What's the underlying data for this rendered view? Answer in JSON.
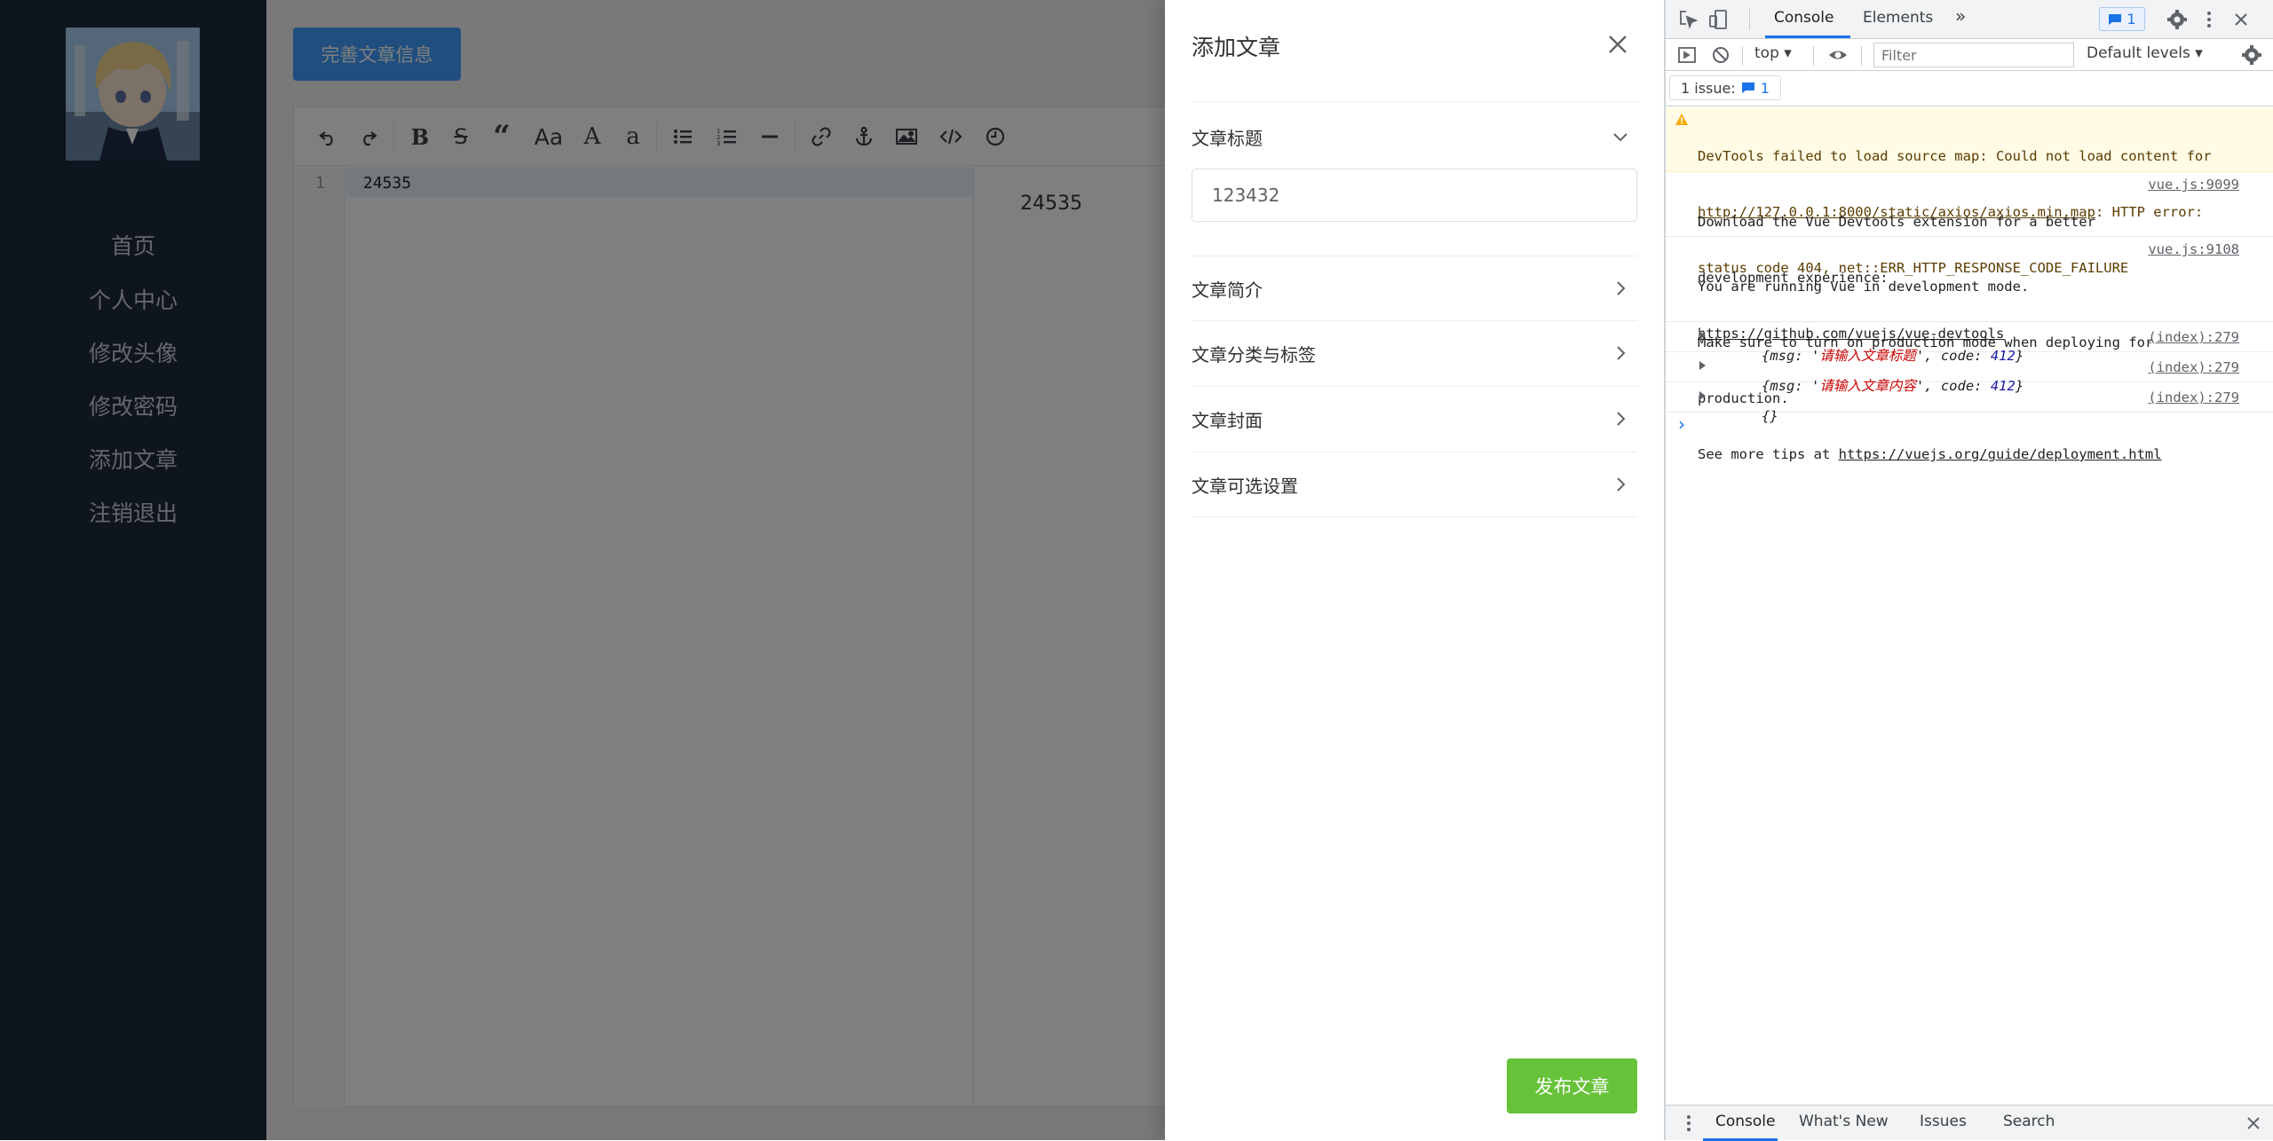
{
  "sidebar": {
    "nav": [
      "首页",
      "个人中心",
      "修改头像",
      "修改密码",
      "添加文章",
      "注销退出"
    ]
  },
  "main": {
    "complete_button": "完善文章信息",
    "editor": {
      "line_number": "1",
      "content": "24535",
      "preview": "24535"
    }
  },
  "drawer": {
    "title": "添加文章",
    "sections": [
      {
        "label": "文章标题",
        "expanded": true
      },
      {
        "label": "文章简介",
        "expanded": false
      },
      {
        "label": "文章分类与标签",
        "expanded": false
      },
      {
        "label": "文章封面",
        "expanded": false
      },
      {
        "label": "文章可选设置",
        "expanded": false
      }
    ],
    "title_input_value": "123432",
    "publish_button": "发布文章",
    "colors": {
      "publish": "#67c23a",
      "primary": "#409eff"
    }
  },
  "devtools": {
    "tabs": [
      "Console",
      "Elements"
    ],
    "badge_count": "1",
    "context": "top ▾",
    "filter_placeholder": "Filter",
    "levels": "Default levels ▾",
    "issues_label": "1 issue:",
    "issues_count": "1",
    "messages": {
      "warning": {
        "line1": "DevTools failed to load source map: Could not load content for",
        "url": "http://127.0.0.1:8000/static/axios/axios.min.map",
        "line2_rest": ": HTTP error:",
        "line3": "status code 404, net::ERR_HTTP_RESPONSE_CODE_FAILURE"
      },
      "devtools_ext": {
        "line1": "Download the Vue Devtools extension for a better",
        "line2": "development experience:",
        "url": "https://github.com/vuejs/vue-devtools",
        "source": "vue.js:9099"
      },
      "dev_mode": {
        "line1": "You are running Vue in development mode.",
        "line2": "Make sure to turn on production mode when deploying for",
        "line3": "production.",
        "line4_prefix": "See more tips at ",
        "url": "https://vuejs.org/guide/deployment.html",
        "source": "vue.js:9108"
      },
      "obj1": {
        "open": "{msg: '",
        "msg": "请输入文章标题",
        "mid": "', code: ",
        "code": "412",
        "close": "}",
        "source": "(index):279"
      },
      "obj2": {
        "open": "{msg: '",
        "msg": "请输入文章内容",
        "mid": "', code: ",
        "code": "412",
        "close": "}",
        "source": "(index):279"
      },
      "obj3": {
        "text": "{}",
        "source": "(index):279"
      }
    },
    "prompt": "›",
    "bottom_tabs": [
      "Console",
      "What's New",
      "Issues",
      "Search"
    ]
  }
}
